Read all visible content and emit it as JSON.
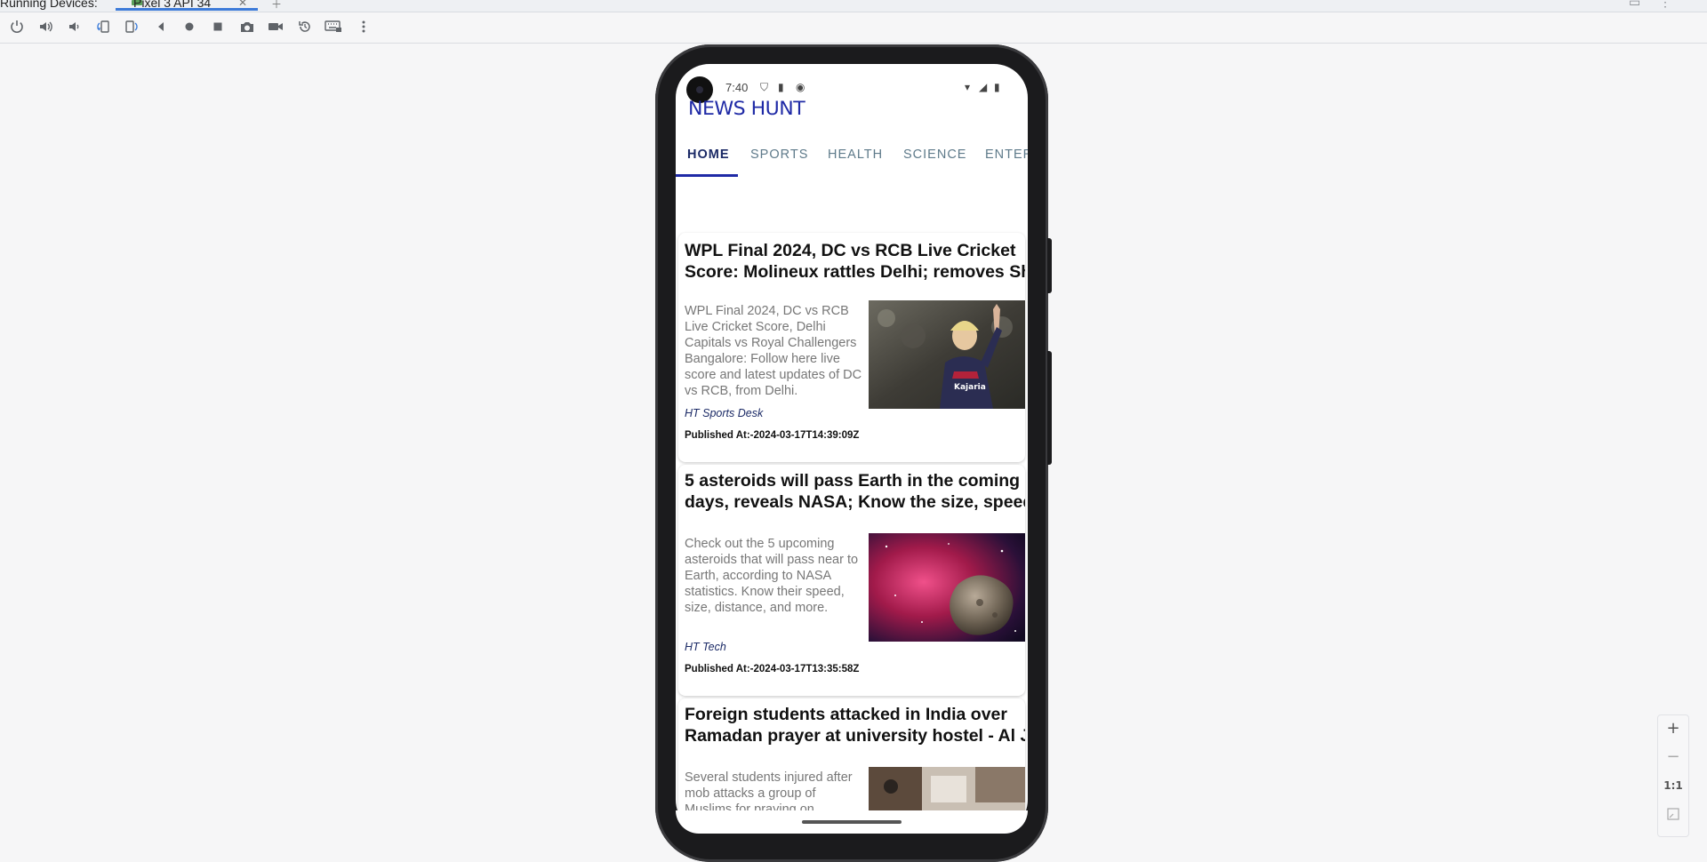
{
  "window": {
    "tabs": [
      {
        "label": "Running Devices:"
      },
      {
        "label": "Pixel 3 API 34"
      }
    ],
    "toolbar_icons": [
      "power-icon",
      "volume-up-icon",
      "volume-down-icon",
      "rotate-left-icon",
      "rotate-right-icon",
      "back-icon",
      "home-icon",
      "overview-icon",
      "screenshot-icon",
      "screen-record-icon",
      "reset-icon",
      "keyboard-icon",
      "more-options-icon"
    ]
  },
  "status_bar": {
    "time": "7:40"
  },
  "app": {
    "logo": "NEWS HUNT",
    "categories": [
      {
        "label": "HOME",
        "active": true
      },
      {
        "label": "SPORTS",
        "active": false
      },
      {
        "label": "HEALTH",
        "active": false
      },
      {
        "label": "SCIENCE",
        "active": false
      },
      {
        "label": "ENTER",
        "active": false
      }
    ],
    "articles": [
      {
        "title_line1": "WPL Final 2024, DC vs RCB Live Cricket",
        "title_line2": "Score: Molineux rattles Delhi; removes Sh",
        "description": "WPL Final 2024, DC vs RCB Live Cricket Score, Delhi Capitals vs Royal Challengers Bangalore: Follow here live score and latest updates of DC vs RCB, from Delhi.",
        "image": "cricket-player-photo",
        "source": "HT Sports Desk",
        "published": "Published At:-2024-03-17T14:39:09Z"
      },
      {
        "title_line1": "5 asteroids will pass Earth in the coming",
        "title_line2": "days, reveals NASA; Know the size, speed,",
        "description": "Check out the 5 upcoming asteroids that will pass near to Earth, according to NASA statistics. Know their speed, size, distance, and more.",
        "image": "asteroid-space-photo",
        "source": "HT Tech",
        "published": "Published At:-2024-03-17T13:35:58Z"
      },
      {
        "title_line1": "Foreign students attacked in India over",
        "title_line2": "Ramadan prayer at university hostel - Al J",
        "description": "Several students injured after mob attacks a group of Muslims for praying on",
        "image": "hostel-room-photo",
        "source": "",
        "published": ""
      }
    ]
  },
  "zoom": {
    "zoom_in": "+",
    "zoom_out": "−",
    "actual_size": "1:1"
  },
  "colors": {
    "brand": "#1f2aa6",
    "active_tab": "#1b2a66",
    "inactive_tab": "#5e7a8a",
    "accent_tab_underline": "#3d7bd9"
  }
}
